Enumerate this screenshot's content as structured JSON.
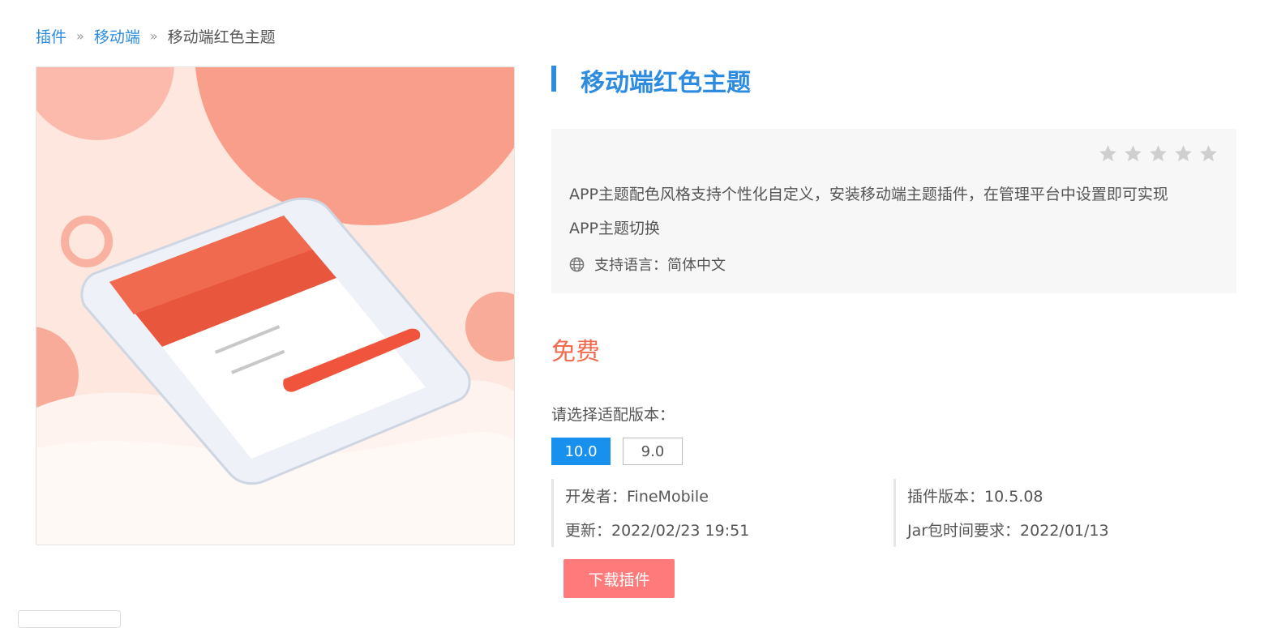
{
  "breadcrumb": {
    "items": [
      "插件",
      "移动端"
    ],
    "separator": "»",
    "current": "移动端红色主题"
  },
  "plugin": {
    "title": "移动端红色主题",
    "rating": 0,
    "description_line1": "APP主题配色风格支持个性化自定义，安装移动端主题插件，在管理平台中设置即可实现",
    "description_line2": "APP主题切换",
    "language_label": "支持语言：",
    "language_value": "简体中文",
    "price": "免费",
    "version_label": "请选择适配版本：",
    "versions": [
      "10.0",
      "9.0"
    ],
    "selected_version": "10.0",
    "developer": "开发者：FineMobile",
    "updated": "更新：2022/02/23 19:51",
    "plugin_version": "插件版本：10.5.08",
    "jar_requirement": "Jar包时间要求：2022/01/13",
    "download_label": "下载插件"
  },
  "colors": {
    "accent": "#2d8ce0",
    "price": "#f26b4f",
    "download": "#ff7b7b",
    "selected_version": "#1890ee"
  },
  "icons": {
    "star": "star-icon",
    "language": "globe-icon"
  }
}
